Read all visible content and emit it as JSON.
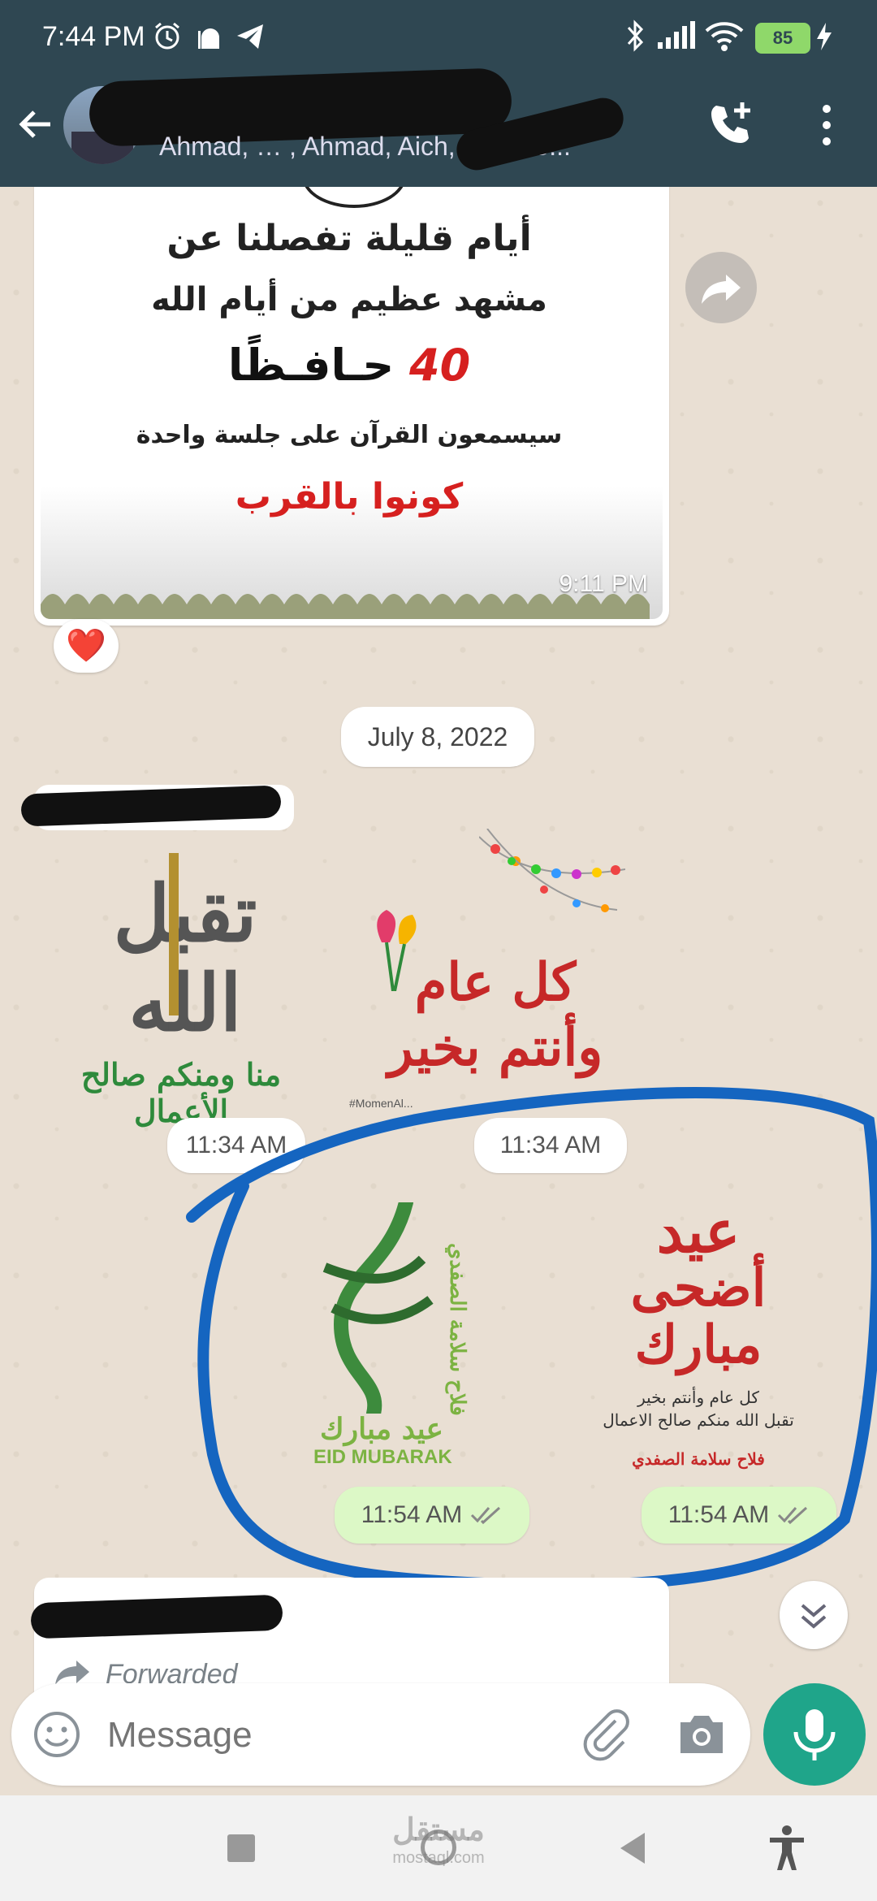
{
  "status_bar": {
    "time": "7:44 PM",
    "battery": "85"
  },
  "header": {
    "participants": "Ahmad, … , Ahmad, Aich, Akila, B..."
  },
  "poster": {
    "line1": "أيام قليلة تفصلنا عن",
    "line2": "مشهد عظيم من أيام الله",
    "line3_num": "40",
    "line3_word": "حـافـظًا",
    "line4": "سيسمعون القرآن على جلسة واحدة",
    "line5": "كونوا بالقرب",
    "time": "9:11 PM",
    "reaction": "❤️"
  },
  "date_chip": "July 8, 2022",
  "stickers_left": {
    "sticker1_main": "تقبل الله",
    "sticker1_sub": "منا ومنكم صالح الأعمال",
    "sticker2_main": "كل عام وأنتم بخير",
    "sticker2_tag": "#MomenAl...",
    "time1": "11:34 AM",
    "time2": "11:34 AM"
  },
  "stickers_right": {
    "sticker3_main": "عيد مبارك",
    "sticker3_side": "فلاح سلامة الصفدي",
    "sticker3_en": "EID MUBARAK",
    "sticker4_line1": "عيد",
    "sticker4_line2": "أضحى",
    "sticker4_line3": "مبارك",
    "sticker4_sub1": "كل عام وأنتم بخير",
    "sticker4_sub2": "تقبل الله منكم صالح الاعمال",
    "sticker4_sig": "فلاح سلامة الصفدي",
    "time3": "11:54 AM",
    "time4": "11:54 AM"
  },
  "forwarded_label": "Forwarded",
  "input": {
    "placeholder": "Message"
  },
  "watermark": "مستقل",
  "watermark_sub": "mostaql.com",
  "colors": {
    "header": "#2f4752",
    "chat_bg": "#e9dfd3",
    "outgoing": "#dcf8c6",
    "accent": "#1fa58a",
    "circle": "#1565c0"
  }
}
